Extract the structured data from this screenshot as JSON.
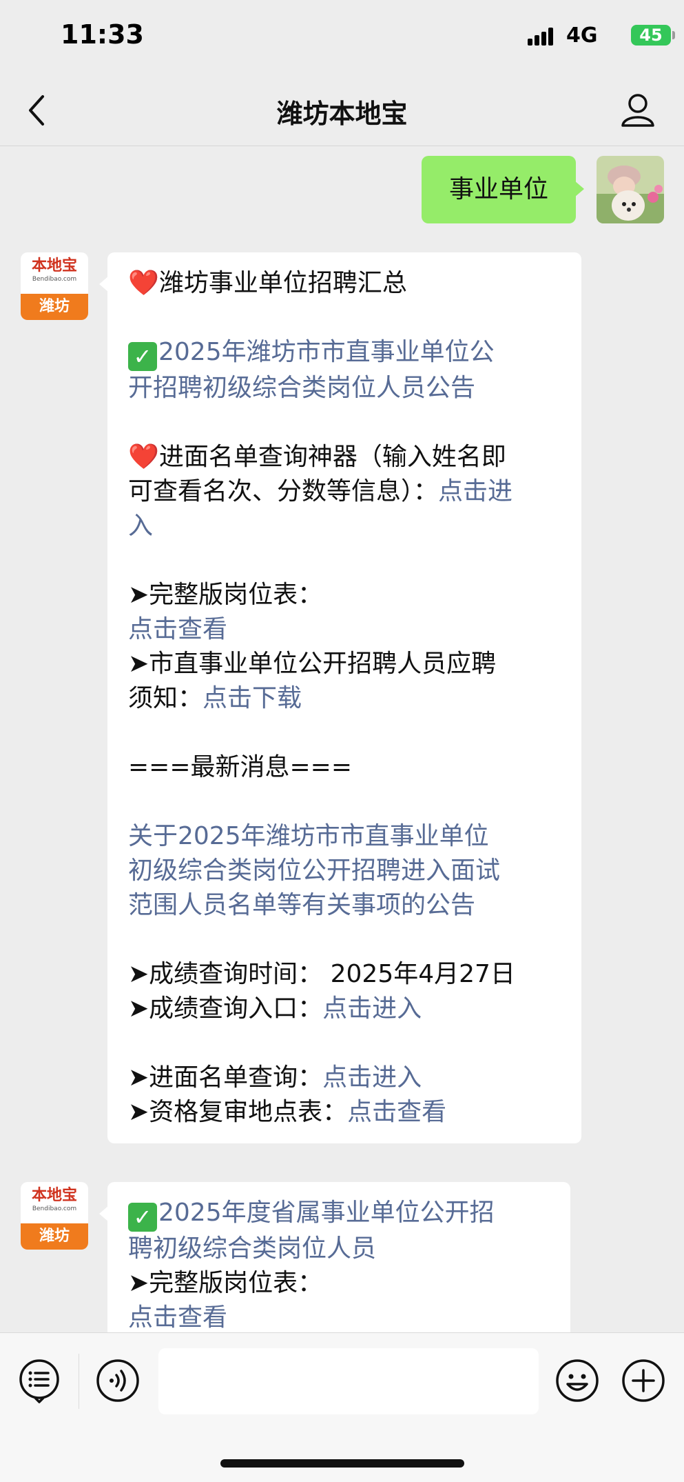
{
  "status": {
    "time": "11:33",
    "network": "4G",
    "battery": "45"
  },
  "nav": {
    "title": "潍坊本地宝",
    "back_icon": "chevron-left-icon",
    "profile_icon": "person-icon"
  },
  "user_message": "事业单位",
  "bot": {
    "logo_text": "本地宝",
    "logo_sub": "Bendibao.com",
    "logo_city": "潍坊"
  },
  "message1": {
    "heart1": "❤️",
    "title": "潍坊事业单位招聘汇总",
    "check1": "✓",
    "notice_link_l1": "2025年潍坊市市直事业单位公",
    "notice_link_l2": "开招聘初级综合类岗位人员公告",
    "heart2": "❤️",
    "query_l1": "进面名单查询神器（输入姓名即",
    "query_l2": "可查看名次、分数等信息）：",
    "query_link_l2": "点击进",
    "query_link_l3": "入",
    "table_label": "➤完整版岗位表：",
    "table_link": "点击查看",
    "notice_label_l1": "➤市直事业单位公开招聘人员应聘",
    "notice_label_l2": "须知：",
    "download_link": "点击下载",
    "latest": "===最新消息===",
    "latest_link_l1": "关于2025年潍坊市市直事业单位",
    "latest_link_l2": "初级综合类岗位公开招聘进入面试",
    "latest_link_l3": "范围人员名单等有关事项的公告",
    "score_time": "➤成绩查询时间：  2025年4月27日",
    "score_entry_label": "➤成绩查询入口：",
    "score_entry_link": "点击进入",
    "interview_label": "➤进面名单查询：",
    "interview_link": "点击进入",
    "review_label": "➤资格复审地点表：",
    "review_link": "点击查看"
  },
  "message2": {
    "check": "✓",
    "link_l1": "2025年度省属事业单位公开招",
    "link_l2": "聘初级综合类岗位人员",
    "table_label": "➤完整版岗位表：",
    "table_link": "点击查看"
  },
  "input_bar": {
    "menu_icon": "list-menu-icon",
    "voice_icon": "voice-icon",
    "emoji_icon": "emoji-icon",
    "plus_icon": "plus-icon"
  }
}
